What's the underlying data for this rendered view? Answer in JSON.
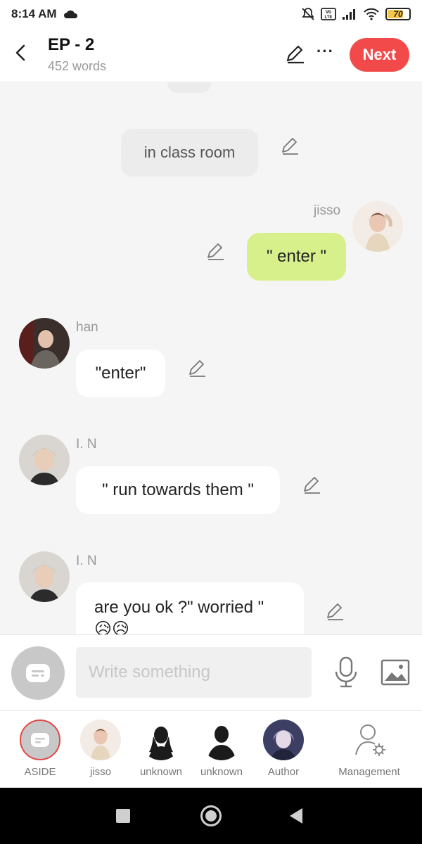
{
  "status_bar": {
    "time": "8:14 AM",
    "battery": "70"
  },
  "header": {
    "title": "EP - 2",
    "word_count": "452 words",
    "next_label": "Next",
    "more_label": "···"
  },
  "chat": {
    "aside_text": "in class room",
    "messages": [
      {
        "speaker": "jisso",
        "text": "\" enter \"",
        "side": "right"
      },
      {
        "speaker": "han",
        "text": "\"enter\"",
        "side": "left"
      },
      {
        "speaker": "I. N",
        "text": "\" run towards them \"",
        "side": "left"
      },
      {
        "speaker": "I. N",
        "text": "are you ok ?\" worried \"",
        "emoji": "😥😥",
        "side": "left"
      }
    ]
  },
  "input": {
    "placeholder": "Write something"
  },
  "characters": [
    {
      "label": "ASIDE"
    },
    {
      "label": "jisso"
    },
    {
      "label": "unknown"
    },
    {
      "label": "unknown"
    },
    {
      "label": "Author"
    },
    {
      "label": "Management"
    }
  ],
  "colors": {
    "accent": "#f24a4a",
    "bubble_green": "#d8f08c",
    "bubble_white": "#ffffff",
    "aside_gray": "#ececec"
  }
}
